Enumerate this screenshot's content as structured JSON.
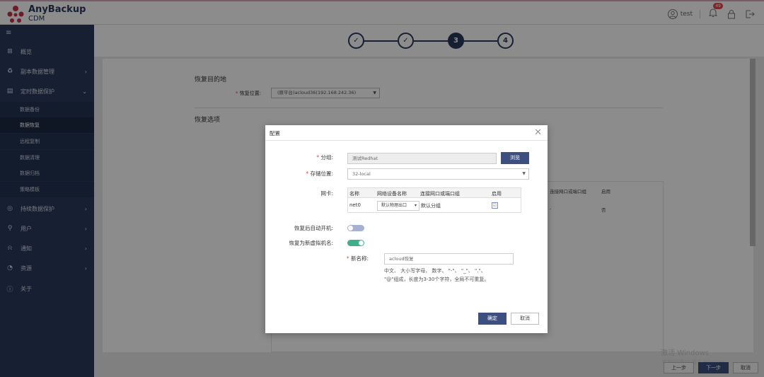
{
  "brand": {
    "name": "AnyBackup",
    "product": "CDM"
  },
  "header": {
    "user": "test",
    "notification_count": "49"
  },
  "sidebar": {
    "items": [
      {
        "label": "概览",
        "icon": "grid-icon"
      },
      {
        "label": "副本数据管理",
        "icon": "recycle-icon"
      },
      {
        "label": "定时数据保护",
        "icon": "archive-icon"
      },
      {
        "label": "持续数据保护",
        "icon": "disc-icon"
      },
      {
        "label": "用户",
        "icon": "user-icon"
      },
      {
        "label": "通知",
        "icon": "bell-icon"
      },
      {
        "label": "资源",
        "icon": "pie-icon"
      },
      {
        "label": "关于",
        "icon": "info-icon"
      }
    ],
    "subitems": [
      "数据备份",
      "数据恢复",
      "远程复制",
      "数据清理",
      "数据归档",
      "策略模板"
    ]
  },
  "wizard": {
    "steps": [
      "✓",
      "✓",
      "3",
      "4"
    ]
  },
  "page": {
    "section_target": "恢复目的地",
    "location_label": "恢复位置:",
    "location_value": "(原平台)acloud36(192.168.242.36)",
    "section_options": "恢复选项",
    "bg_table_headers": [
      "连接网口或端口组",
      "启用"
    ],
    "bg_table_row": [
      "-",
      "否"
    ]
  },
  "footer": {
    "prev": "上一步",
    "next": "下一步",
    "cancel": "取消"
  },
  "watermark": {
    "line1": "激活 Windows",
    "line2": "转到\"设置\"以激活 Windows。"
  },
  "dialog": {
    "title": "配置",
    "group_label": "分组:",
    "group_value": "测试Redhat",
    "browse": "浏览",
    "storage_label": "存储位置:",
    "storage_value": "32-local",
    "nic_label": "网卡:",
    "nic_headers": [
      "名称",
      "网络设备名称",
      "连接网口或端口组",
      "启用"
    ],
    "nic_row": {
      "name": "net0",
      "device": "默认物理出口",
      "group": "默认分组",
      "enabled": "☑"
    },
    "autostart_label": "恢复后自动开机:",
    "newvm_label": "恢复为新虚拟机名:",
    "newname_label": "新名称:",
    "newname_value": "acloud恢复",
    "hint_line1": "中文、 大小写字母、 数字、 \"-\"、 \"_\"、 \".\"、",
    "hint_line2": "\"@\"组成，长度为3-30个字符，全局不可重复。",
    "ok": "确定",
    "cancel": "取消"
  }
}
